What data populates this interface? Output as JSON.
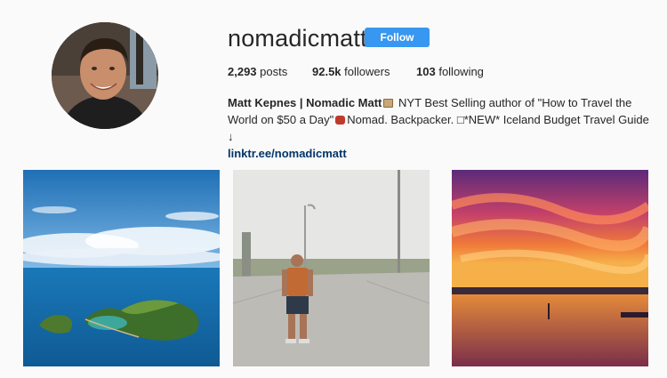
{
  "profile": {
    "username": "nomadicmatt",
    "follow_label": "Follow"
  },
  "stats": {
    "posts_count": "2,293",
    "posts_label": "posts",
    "followers_count": "92.5k",
    "followers_label": "followers",
    "following_count": "103",
    "following_label": "following"
  },
  "bio": {
    "name": "Matt Kepnes | Nomadic Matt",
    "text_part1": "NYT Best Selling author of \"How to Travel the World on $50 a Day\"",
    "text_part2": "Nomad. Backpacker.",
    "text_part3": "*NEW* Iceland Budget Travel Guide",
    "link": "linktr.ee/nomadicmatt"
  },
  "icons": {
    "bio_emoji_1": "handbag-emoji-icon",
    "bio_emoji_2": "backpack-emoji-icon",
    "bio_emoji_3": "unsupported-glyph-icon",
    "bio_arrow": "down-arrow-icon"
  },
  "posts": [
    {
      "subject": "island-aerial-photo"
    },
    {
      "subject": "backpacker-on-road-photo"
    },
    {
      "subject": "sunset-sky-over-water-photo"
    }
  ],
  "colors": {
    "accent": "#3897f0",
    "link": "#003569",
    "background": "#fafafa",
    "text": "#262626"
  }
}
